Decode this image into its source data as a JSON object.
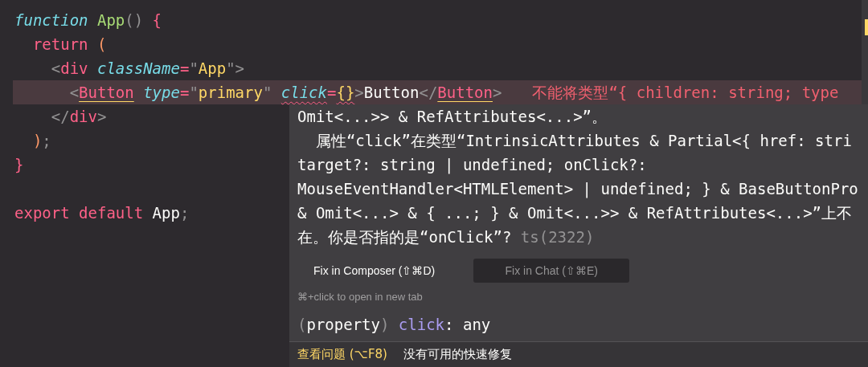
{
  "editor": {
    "lines": [
      {
        "highlighted": false,
        "tokens": [
          {
            "kind": "storage",
            "text": "function"
          },
          {
            "kind": "fn",
            "text": "App",
            "space_before": true
          },
          {
            "kind": "paren",
            "text": "()"
          },
          {
            "kind": "keyword",
            "text": "{",
            "space_before": true
          }
        ],
        "children": [
          {
            "highlighted": false,
            "tokens": [
              {
                "kind": "keyword",
                "text": "return"
              },
              {
                "kind": "orange",
                "text": "(",
                "space_before": true
              }
            ],
            "children": [
              {
                "highlighted": false,
                "tokens": [
                  {
                    "kind": "punct",
                    "text": "<"
                  },
                  {
                    "kind": "keyword",
                    "text": "div"
                  },
                  {
                    "kind": "attr",
                    "text": "className",
                    "space_before": true
                  },
                  {
                    "kind": "keyword",
                    "text": "="
                  },
                  {
                    "kind": "punct",
                    "text": "\""
                  },
                  {
                    "kind": "string",
                    "text": "App"
                  },
                  {
                    "kind": "punct",
                    "text": "\">"
                  }
                ],
                "children": [
                  {
                    "highlighted": true,
                    "tokens": [
                      {
                        "kind": "punct",
                        "text": "<"
                      },
                      {
                        "kind": "keyword",
                        "text": "Button",
                        "warning": true
                      },
                      {
                        "kind": "attr",
                        "text": "type",
                        "space_before": true
                      },
                      {
                        "kind": "keyword",
                        "text": "="
                      },
                      {
                        "kind": "punct",
                        "text": "\""
                      },
                      {
                        "kind": "string",
                        "text": "primary"
                      },
                      {
                        "kind": "punct",
                        "text": "\""
                      },
                      {
                        "kind": "attr",
                        "text": "click",
                        "error": true,
                        "space_before": true
                      },
                      {
                        "kind": "keyword",
                        "text": "="
                      },
                      {
                        "kind": "string",
                        "text": "{}",
                        "error": true
                      },
                      {
                        "kind": "punct",
                        "text": ">"
                      },
                      {
                        "kind": "plain",
                        "text": "Button"
                      },
                      {
                        "kind": "punct",
                        "text": "</"
                      },
                      {
                        "kind": "keyword",
                        "text": "Button",
                        "warning": true
                      },
                      {
                        "kind": "punct",
                        "text": ">"
                      }
                    ],
                    "inline_error": "不能将类型“{ children: string; type"
                  }
                ]
              },
              {
                "highlighted": false,
                "tokens": [
                  {
                    "kind": "punct",
                    "text": "</"
                  },
                  {
                    "kind": "keyword",
                    "text": "div"
                  },
                  {
                    "kind": "punct",
                    "text": ">"
                  }
                ]
              }
            ]
          },
          {
            "highlighted": false,
            "tokens": [
              {
                "kind": "orange",
                "text": ")"
              },
              {
                "kind": "punct",
                "text": ";"
              }
            ]
          }
        ]
      },
      {
        "highlighted": false,
        "tokens": [
          {
            "kind": "keyword",
            "text": "}"
          }
        ]
      },
      {
        "highlighted": false
      },
      {
        "highlighted": false,
        "tokens": [
          {
            "kind": "keyword",
            "text": "export"
          },
          {
            "kind": "keyword",
            "text": "default",
            "space_before": true
          },
          {
            "kind": "plain",
            "text": "App",
            "space_before": true
          },
          {
            "kind": "punct",
            "text": ";"
          }
        ]
      }
    ]
  },
  "hover": {
    "message_lines": [
      "Omit<...>> & RefAttributes<...>”。",
      "  属性“click”在类型“IntrinsicAttributes & Partial<{ href: stri",
      "target?: string | undefined; onClick?:",
      "MouseEventHandler<HTMLElement> | undefined; } & BaseButtonPro",
      "& Omit<...> & { ...; } & Omit<...>> & RefAttributes<...>”上不",
      "在。你是否指的是“onClick”?"
    ],
    "error_code": "ts(2322)",
    "buttons": [
      {
        "label": "Fix in Composer (⇧⌘D)",
        "selected": true
      },
      {
        "label": "Fix in Chat (⇧⌘E)",
        "selected": false
      }
    ],
    "hint": "⌘+click to open in new tab",
    "signature": [
      {
        "kind": "punct",
        "text": "("
      },
      {
        "kind": "plain",
        "text": "property"
      },
      {
        "kind": "punct",
        "text": ")"
      },
      {
        "kind": "prop",
        "text": "click",
        "space_before": true
      },
      {
        "kind": "plain",
        "text": ": any"
      }
    ],
    "footer": {
      "link": "查看问题 (⌥F8)",
      "text": "没有可用的快速修复"
    }
  }
}
